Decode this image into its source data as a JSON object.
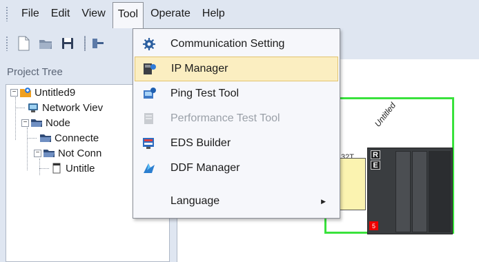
{
  "menubar": {
    "items": [
      "File",
      "Edit",
      "View",
      "Tool",
      "Operate",
      "Help"
    ]
  },
  "toolbar": {
    "icons": [
      "new-file-icon",
      "open-folder-icon",
      "save-icon",
      "connect-icon"
    ]
  },
  "project_tree": {
    "header": "Project Tree",
    "items": [
      {
        "label": "Untitled9",
        "icon": "project-icon"
      },
      {
        "label": "Network Viev",
        "icon": "monitor-icon"
      },
      {
        "label": "Node",
        "icon": "folder-icon"
      },
      {
        "label": "Connecte",
        "icon": "folder-icon"
      },
      {
        "label": "Not Conn",
        "icon": "folder-icon"
      },
      {
        "label": "Untitle",
        "icon": "document-icon"
      }
    ]
  },
  "tool_menu": {
    "items": [
      {
        "label": "Communication Setting",
        "icon": "gear-icon",
        "state": "normal"
      },
      {
        "label": "IP Manager",
        "icon": "ip-manager-icon",
        "state": "hover"
      },
      {
        "label": "Ping Test Tool",
        "icon": "ping-icon",
        "state": "normal"
      },
      {
        "label": "Performance Test Tool",
        "icon": "performance-icon",
        "state": "disabled"
      },
      {
        "label": "EDS Builder",
        "icon": "eds-builder-icon",
        "state": "normal"
      },
      {
        "label": "DDF Manager",
        "icon": "ddf-manager-icon",
        "state": "normal"
      },
      {
        "label": "Language",
        "icon": "",
        "state": "submenu"
      }
    ]
  },
  "canvas": {
    "node_label": "Untitled",
    "device_code": "32T",
    "plc_badges": [
      "R",
      "E"
    ],
    "plc_red_badge": "5"
  },
  "colors": {
    "menubar_bg": "#dfe6f1",
    "hover_bg": "#fbeec1",
    "node_border": "#39e23c"
  }
}
